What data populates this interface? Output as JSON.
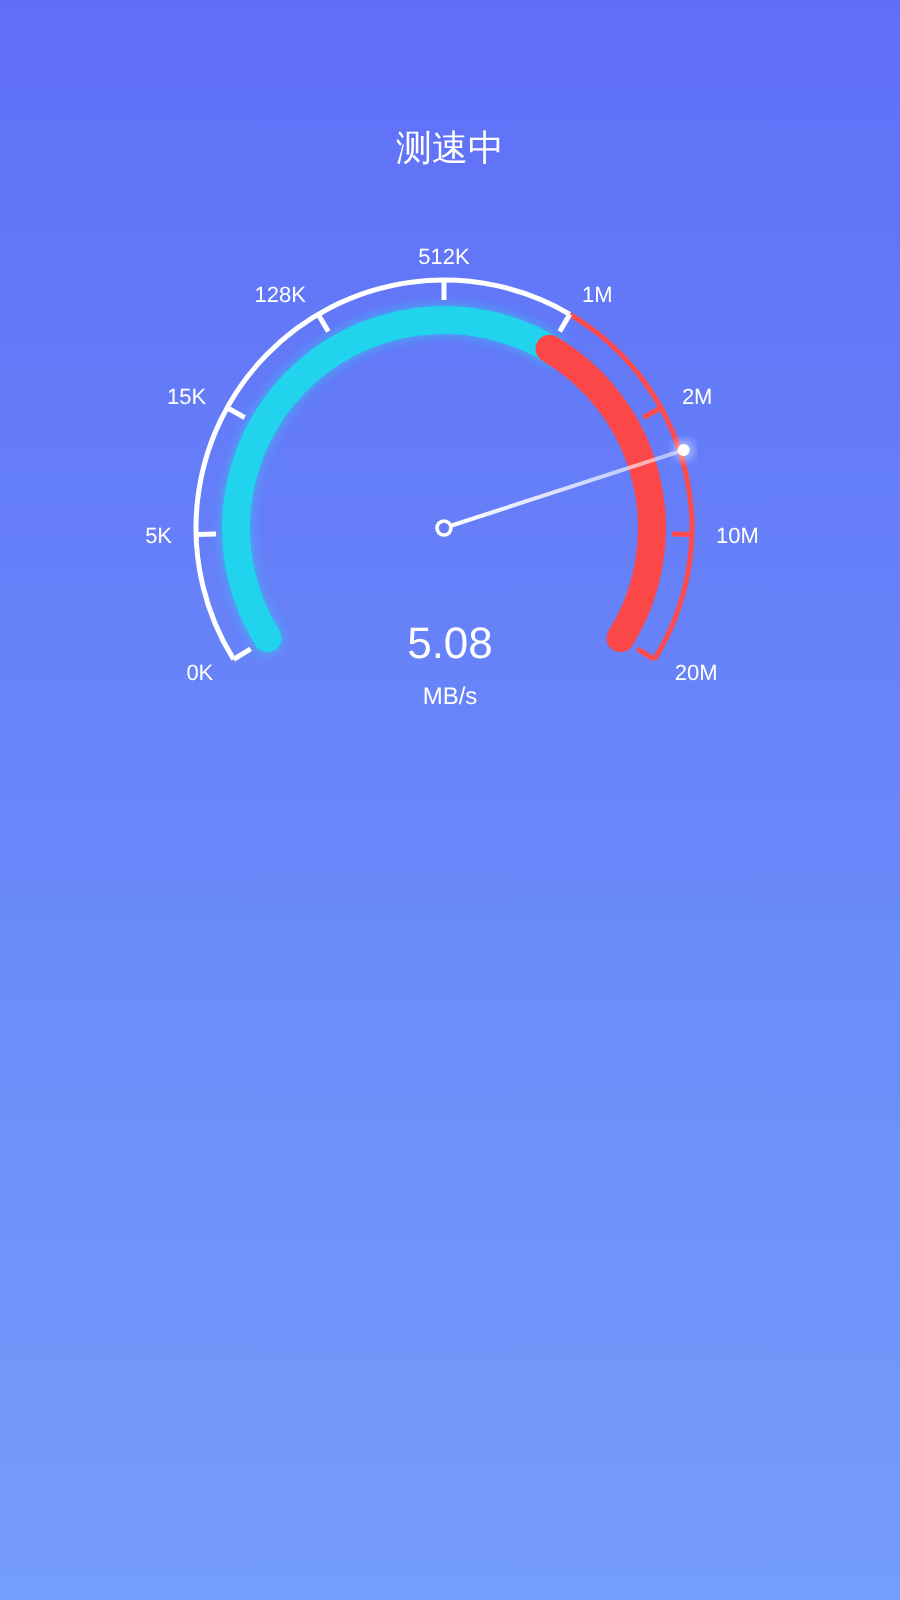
{
  "title": "测速中",
  "gauge": {
    "scale_labels": [
      "0K",
      "5K",
      "15K",
      "128K",
      "512K",
      "1M",
      "2M",
      "10M",
      "20M"
    ],
    "value": "5.08",
    "unit": "MB/s"
  }
}
